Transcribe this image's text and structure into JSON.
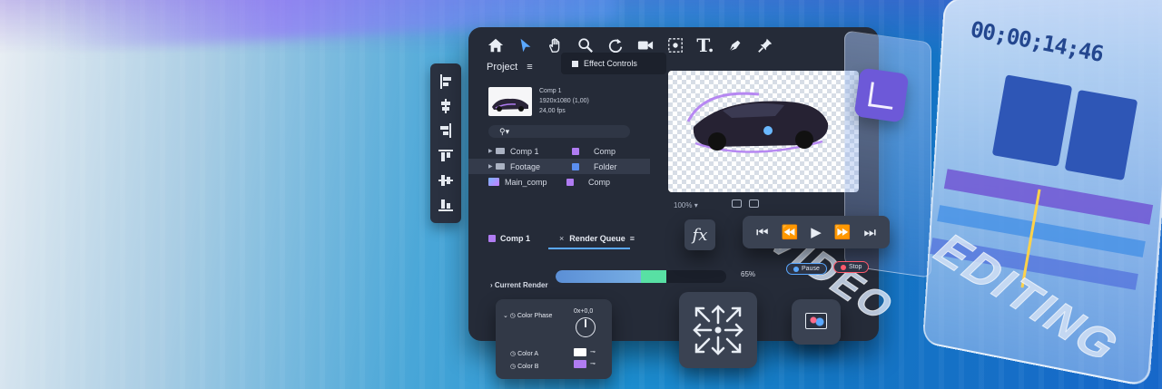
{
  "toolbar": {
    "tools": [
      "home-icon",
      "select-arrow-icon",
      "hand-icon",
      "zoom-icon",
      "rotate-icon",
      "camera-icon",
      "anchor-icon",
      "text-icon",
      "pen-icon",
      "pin-icon"
    ],
    "active_tool": "select-arrow-icon"
  },
  "project": {
    "title": "Project",
    "menu_glyph": "≡",
    "effect_controls_tab": "Effect Controls",
    "comp_name": "Comp 1",
    "comp_resolution": "1920x1080 (1,00)",
    "comp_fps": "24,00 fps",
    "search_glyph": "⚲▾",
    "items": [
      {
        "name": "Comp 1",
        "type": "Comp",
        "kind": "folder",
        "color": "#b07cf2",
        "selected": false
      },
      {
        "name": "Footage",
        "type": "Folder",
        "kind": "folder",
        "color": "#5b8ff0",
        "selected": true
      },
      {
        "name": "Main_comp",
        "type": "Comp",
        "kind": "image",
        "color": "#b07cf2",
        "selected": false
      }
    ]
  },
  "preview": {
    "zoom_label": "100%"
  },
  "bottom_tabs": {
    "comp_tab": "Comp 1",
    "close_glyph": "×",
    "render_queue_tab": "Render Queue",
    "menu_glyph": "≡"
  },
  "render": {
    "label": "Current Render",
    "progress": 0.65,
    "percent_text": "65%",
    "pause_label": "Pause",
    "stop_label": "Stop"
  },
  "fx": {
    "label": "fx"
  },
  "transport": {
    "buttons": [
      "⏮",
      "⏪",
      "▶",
      "⏩",
      "⏭"
    ]
  },
  "color_card": {
    "phase_label": "Color Phase",
    "phase_value": "0x+0,0",
    "color_a_label": "Color A",
    "color_b_label": "Color B",
    "color_a": "#ffffff",
    "color_b": "#b07cf2"
  },
  "decor": {
    "timecode": "00;00;14;46",
    "word_video": "VIDEO",
    "word_editing": "EDITING"
  }
}
